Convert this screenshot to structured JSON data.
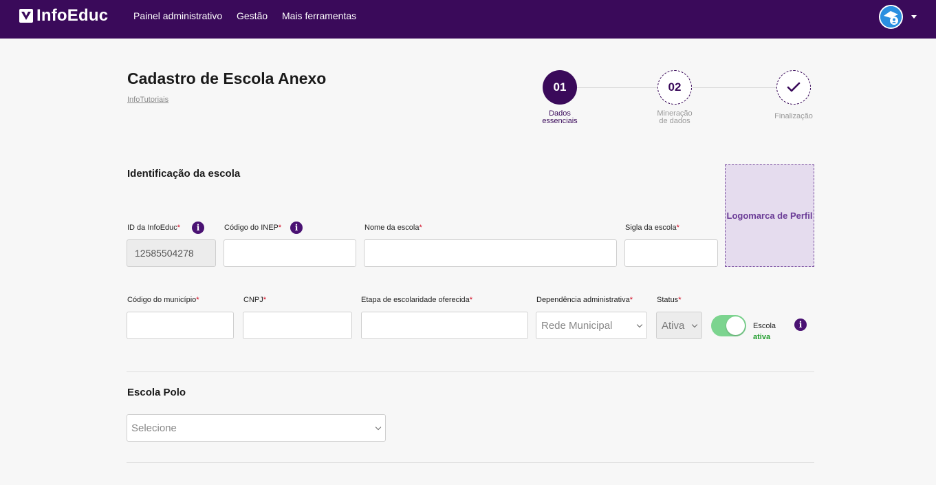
{
  "header": {
    "brand": "InfoEduc",
    "nav": [
      "Painel administrativo",
      "Gestão",
      "Mais ferramentas"
    ],
    "colors": {
      "bar": "#3a0a5a",
      "accent": "#4a1273"
    }
  },
  "page": {
    "title": "Cadastro de Escola Anexo",
    "breadcrumb": "InfoTutoriais"
  },
  "stepper": {
    "steps": [
      {
        "number": "01",
        "label_line1": "Dados",
        "label_line2": "essenciais",
        "state": "active"
      },
      {
        "number": "02",
        "label_line1": "Mineração",
        "label_line2": "de dados",
        "state": "pending"
      },
      {
        "number": "✓",
        "label_line1": "Finalização",
        "label_line2": "",
        "state": "pending"
      }
    ]
  },
  "identification": {
    "title": "Identificação da escola",
    "logo_box": "Logomarca de Perfil",
    "fields": {
      "id_infoeduc": {
        "label": "ID da InfoEduc",
        "req": "*",
        "value": "12585504278"
      },
      "codigo_inep": {
        "label": "Código do INEP",
        "req": "*",
        "value": ""
      },
      "nome_escola": {
        "label": "Nome da escola",
        "req": "*",
        "value": ""
      },
      "sigla_escola": {
        "label": "Sigla da escola",
        "req": "*",
        "value": ""
      },
      "codigo_municipio": {
        "label": "Código do município",
        "req": "*",
        "value": ""
      },
      "cnpj": {
        "label": "CNPJ",
        "req": "*",
        "value": ""
      },
      "etapa": {
        "label": "Etapa de escolaridade oferecida",
        "req": "*",
        "value": ""
      },
      "dependencia": {
        "label": "Dependência administrativa",
        "req": "*",
        "value": "Rede Municipal"
      },
      "status": {
        "label": "Status",
        "req": "*",
        "value": "Ativa"
      }
    },
    "toggle": {
      "line1": "Escola",
      "line2": "ativa",
      "on": true
    }
  },
  "polo": {
    "title": "Escola Polo",
    "select_value": "Selecione"
  }
}
